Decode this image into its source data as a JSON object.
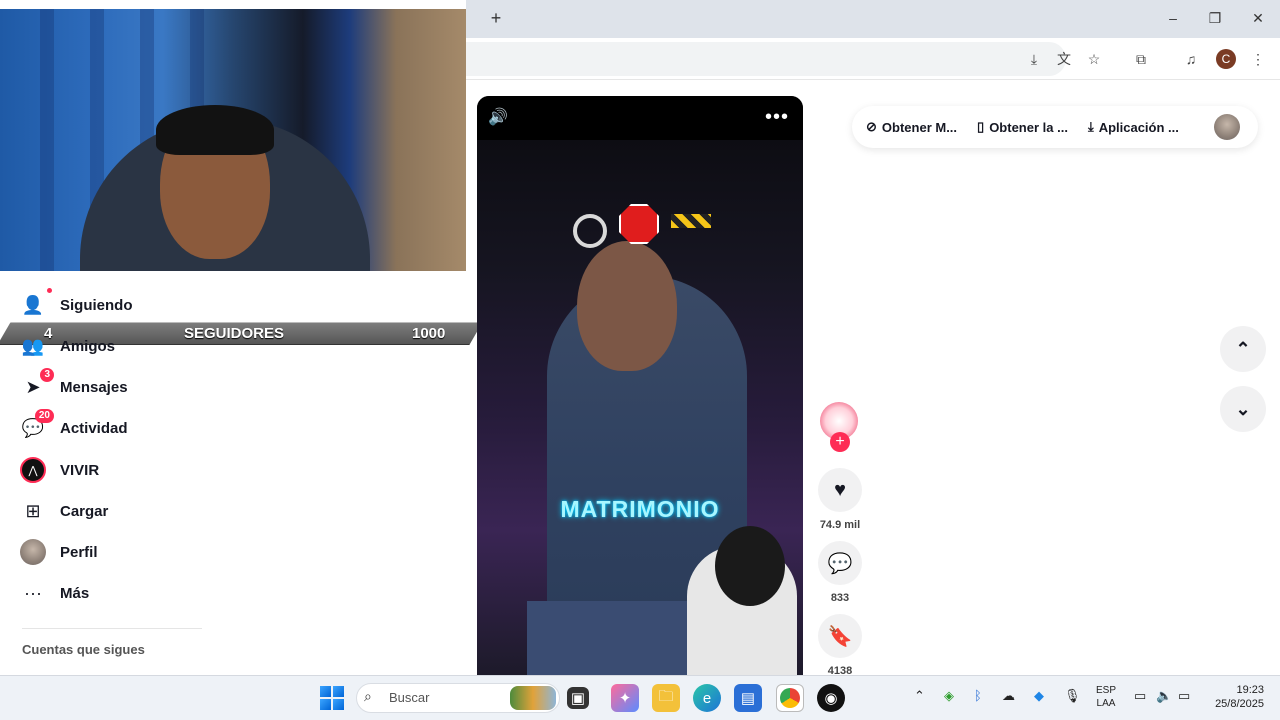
{
  "browser": {
    "new_tab": "+",
    "window_controls": {
      "minimize": "–",
      "restore": "❐",
      "close": "✕"
    },
    "toolbar_icons": [
      "install-icon",
      "translate-icon",
      "star-icon",
      "extensions-icon",
      "media-icon"
    ],
    "profile_initial": "C"
  },
  "sidebar": {
    "items": [
      {
        "label": "Siguiendo",
        "icon": "following-icon"
      },
      {
        "label": "Amigos",
        "icon": "friends-icon"
      },
      {
        "label": "Mensajes",
        "icon": "messages-icon",
        "badge": "3"
      },
      {
        "label": "Actividad",
        "icon": "activity-icon",
        "badge": "20"
      },
      {
        "label": "VIVIR",
        "icon": "live-icon"
      },
      {
        "label": "Cargar",
        "icon": "upload-icon"
      },
      {
        "label": "Perfil",
        "icon": "profile-avatar"
      },
      {
        "label": "Más",
        "icon": "more-icon"
      }
    ],
    "following_accounts_title": "Cuentas que sigues"
  },
  "follower_goal": {
    "current": "4",
    "label": "SEGUIDORES",
    "target": "1000"
  },
  "video": {
    "caption": "MATRIMONIO",
    "stats": {
      "likes": "74.9 mil",
      "comments": "833",
      "saves": "4138"
    }
  },
  "top_right": {
    "items": [
      "Obtener M...",
      "Obtener la ...",
      "Aplicación ..."
    ]
  },
  "taskbar": {
    "search_placeholder": "Buscar",
    "lang_line1": "ESP",
    "lang_line2": "LAA",
    "time": "19:23",
    "date": "25/8/2025"
  },
  "colors": {
    "accent": "#fe2c55",
    "caption": "#a7f6ff",
    "tabstrip": "#dee3ea",
    "taskbar": "#eef2f7"
  }
}
